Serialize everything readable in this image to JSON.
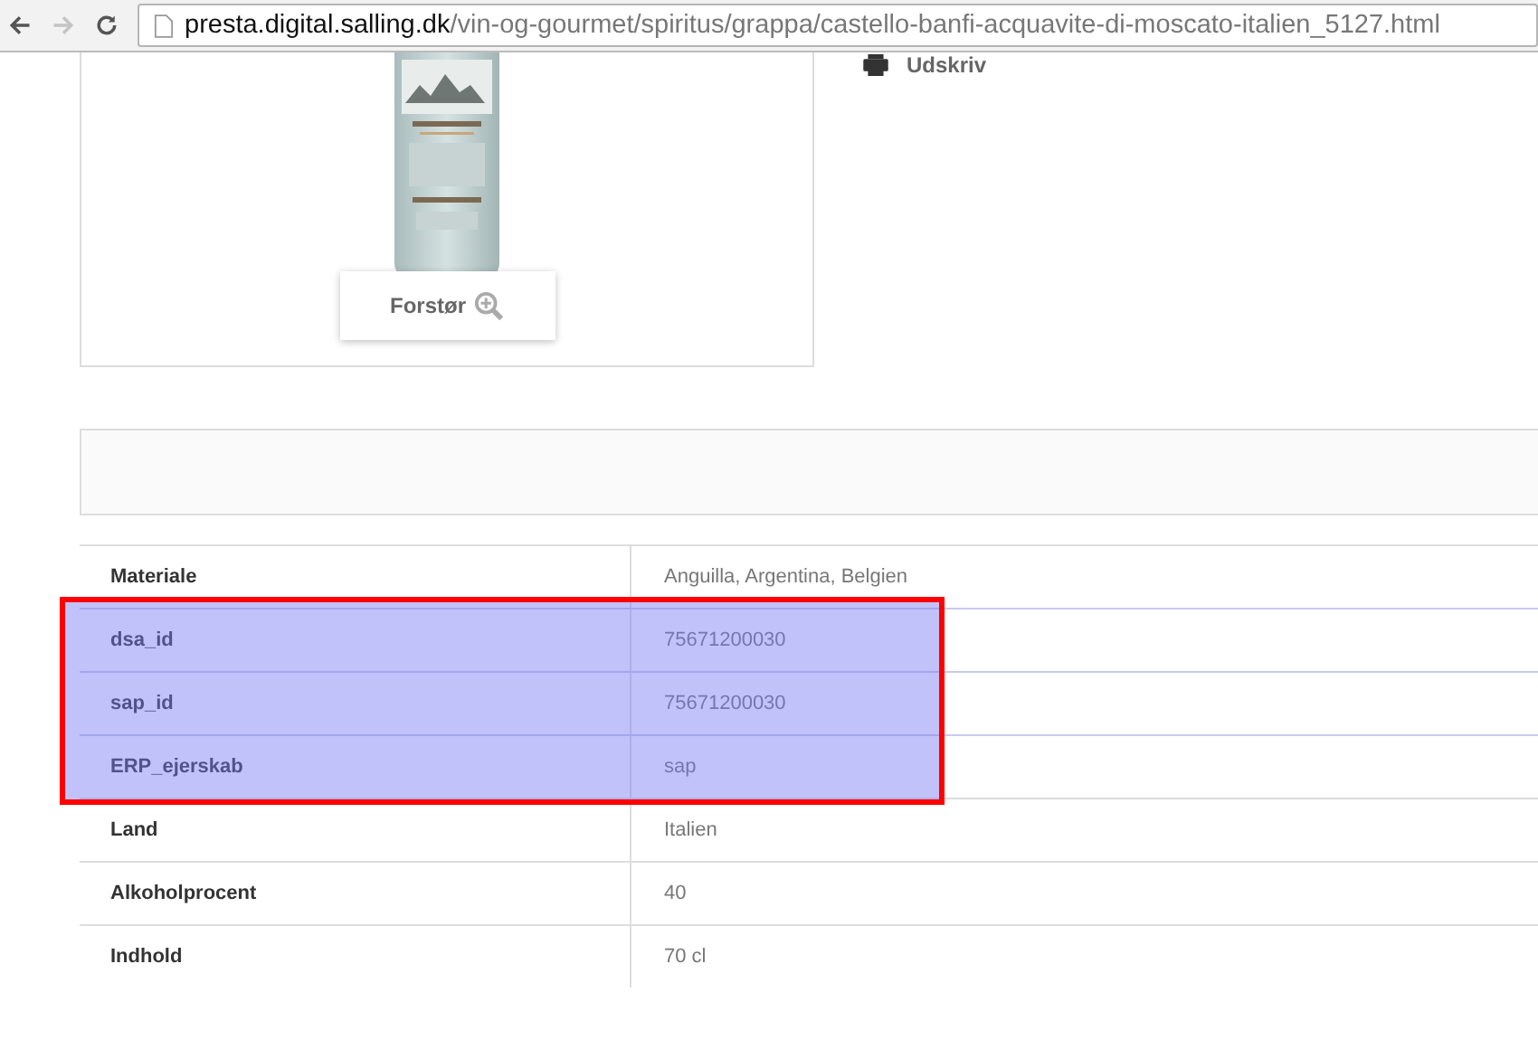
{
  "browser": {
    "url_domain": "presta.digital.salling.dk",
    "url_path": "/vin-og-gourmet/spiritus/grappa/castello-banfi-acquavite-di-moscato-italien_5127.html",
    "forward_disabled": true
  },
  "product": {
    "zoom_button": "Forstør",
    "print_link": "Udskriv"
  },
  "attributes": [
    {
      "name": "Materiale",
      "value": "Anguilla, Argentina, Belgien",
      "highlighted": false
    },
    {
      "name": "dsa_id",
      "value": "75671200030",
      "highlighted": true
    },
    {
      "name": "sap_id",
      "value": "75671200030",
      "highlighted": true
    },
    {
      "name": "ERP_ejerskab",
      "value": "sap",
      "highlighted": true
    },
    {
      "name": "Land",
      "value": "Italien",
      "highlighted": false
    },
    {
      "name": "Alkoholprocent",
      "value": "40",
      "highlighted": false
    },
    {
      "name": "Indhold",
      "value": "70 cl",
      "highlighted": false
    }
  ]
}
